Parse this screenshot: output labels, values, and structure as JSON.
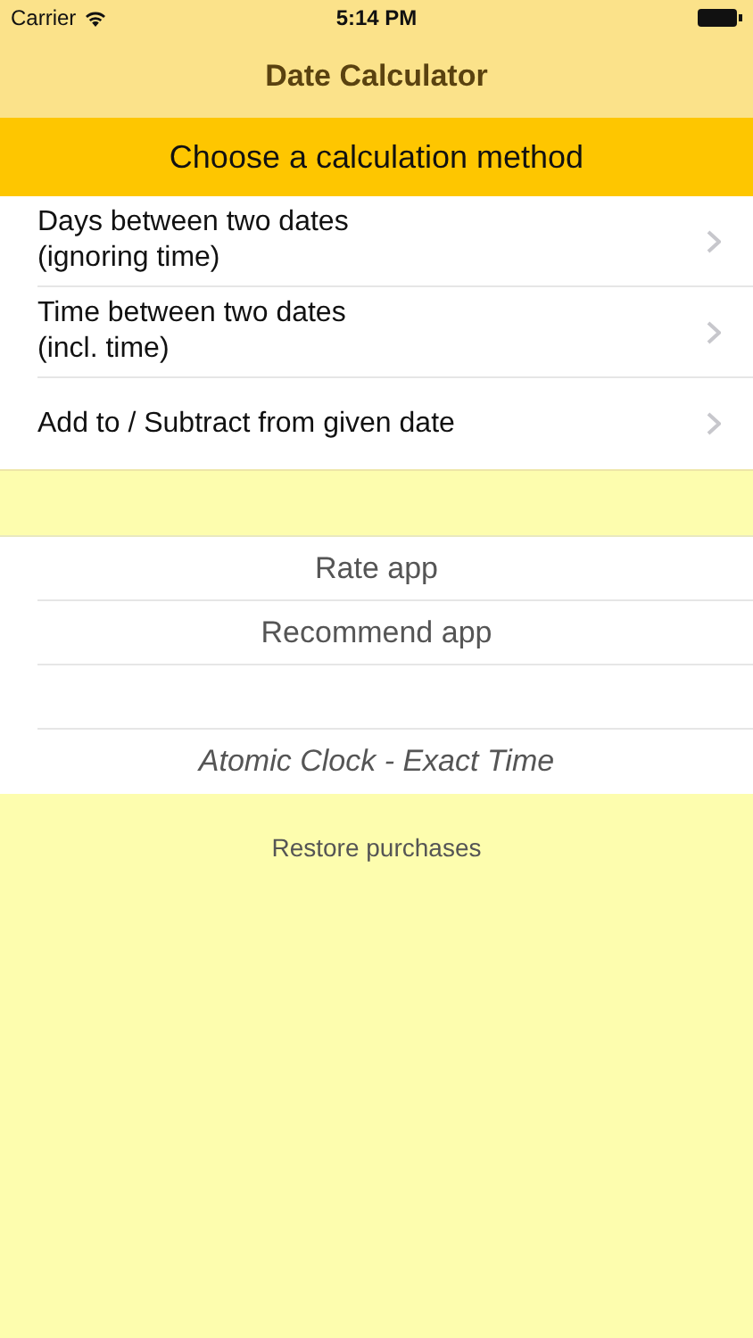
{
  "status_bar": {
    "carrier": "Carrier",
    "time": "5:14 PM"
  },
  "nav": {
    "title": "Date Calculator"
  },
  "section_header": "Choose a calculation method",
  "methods": [
    {
      "lines": [
        "Days between two dates",
        "(ignoring time)"
      ]
    },
    {
      "lines": [
        "Time between two dates",
        "(incl. time)"
      ]
    },
    {
      "lines": [
        "Add to / Subtract from given date"
      ]
    }
  ],
  "extras": [
    {
      "kind": "plain",
      "label": "Rate app"
    },
    {
      "kind": "plain",
      "label": "Recommend app"
    },
    {
      "kind": "blank"
    },
    {
      "kind": "italic",
      "label": "Atomic Clock - Exact Time"
    }
  ],
  "restore": "Restore purchases"
}
